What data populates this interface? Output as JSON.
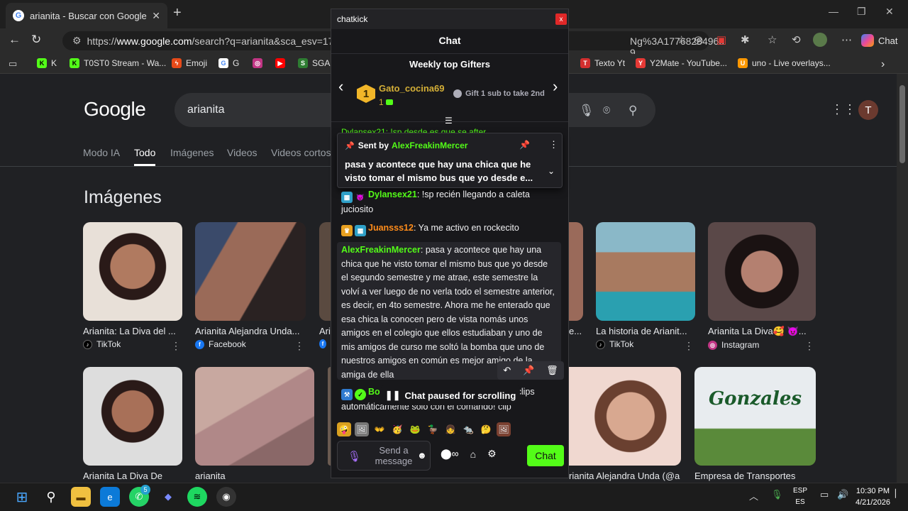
{
  "browser": {
    "tab_title": "arianita - Buscar con Google",
    "url_host": "www.google.com",
    "url_path": "/search?q=arianita&sca_esv=17de63e8",
    "url_tail": "Ng%3A17768284965​9...",
    "chat_label": "Chat",
    "bookmarks": [
      {
        "label": "K",
        "color": "#53fc18"
      },
      {
        "label": "T0ST0 Stream - Wa...",
        "color": "#53fc18"
      },
      {
        "label": "Emoji",
        "color": "#e64a19"
      },
      {
        "label": "G",
        "color": "#4285f4"
      },
      {
        "label": "",
        "color": "#c13584"
      },
      {
        "label": "",
        "color": "#ff0000"
      },
      {
        "label": "SGA",
        "color": "#2e7d32"
      },
      {
        "label": "Texto Yt",
        "color": "#d32f2f"
      },
      {
        "label": "Y2Mate - YouTube...",
        "color": "#e53935"
      },
      {
        "label": "uno - Live overlays...",
        "color": "#ff9800"
      }
    ]
  },
  "google": {
    "logo": "Google",
    "query": "arianita",
    "tabs": [
      "Modo IA",
      "Todo",
      "Imágenes",
      "Videos",
      "Videos cortos"
    ],
    "active_tab": "Todo",
    "avatar_letter": "T",
    "images_heading": "Imágenes",
    "row1": [
      {
        "caption": "Arianita: La Diva del ...",
        "source": "TikTok",
        "src_color": "#000000",
        "tone": "#7a4a3a"
      },
      {
        "caption": "Arianita Alejandra Unda...",
        "source": "Facebook",
        "src_color": "#1877f2",
        "tone": "#8a6a55"
      },
      {
        "caption": "Ari",
        "source": "",
        "src_color": "#1877f2",
        "tone": "#5a4a40"
      }
    ],
    "row1_right": [
      {
        "caption": "e...",
        "source": "",
        "src_color": "#000000",
        "tone": "#8a5a4a"
      },
      {
        "caption": "La historia de Arianit...",
        "source": "TikTok",
        "src_color": "#000000",
        "tone": "#5a8a9a"
      },
      {
        "caption": "Arianita La Diva🥰 😈...",
        "source": "Instagram",
        "src_color": "#c13584",
        "tone": "#6a5050"
      }
    ],
    "row2": [
      {
        "caption": "Arianita La Diva De",
        "tone": "#7a5a4a"
      },
      {
        "caption": "arianita",
        "tone": "#b89890"
      }
    ],
    "row2_right": [
      {
        "caption": "rianita Alejandra Unda (@a",
        "tone": "#c89a88"
      },
      {
        "caption": "Empresa de Transportes",
        "tone": "#d8dde0"
      }
    ],
    "bus_text": "Gonzales"
  },
  "chatkick": {
    "window_title": "chatkick",
    "close": "x",
    "chat_title": "Chat",
    "gifters_title": "Weekly top Gifters",
    "gifter": {
      "rank": "1",
      "name": "Gato_cocina69",
      "count": "1"
    },
    "gift_note": "Gift 1 sub to take 2nd",
    "behind_line": "Dylansex21: !sp desde es que se after",
    "pinned": {
      "sent_by": "Sent by",
      "user": "AlexFreakinMercer",
      "text": "pasa y acontece que hay una chica que he visto tomar el mismo bus que yo desde e..."
    },
    "messages": [
      {
        "user": "Dylansex21",
        "user_color": "#53fc18",
        "text": ": !sp recién llegando a caleta juciosito"
      },
      {
        "user": "Juansss12",
        "user_color": "#ff8c1a",
        "text": ": Ya me activo en rockecito"
      }
    ],
    "long_message": {
      "user": "AlexFreakinMercer",
      "user_color": "#53fc18",
      "text": ": pasa y acontece que hay una chica que he visto tomar el mismo bus que yo desde el segundo semestre y me atrae, este semestre la volví a ver luego de no verla todo el semestre anterior, es decir, en 4to semestre. Ahora me he enterado que esa chica la conocen pero de vista nomás unos amigos en el colegio que ellos estudiaban y uno de mis amigos de curso me soltó la bomba que uno de nuestros amigos en común es mejor amigo de la amiga de ella"
    },
    "last_message": {
      "user": "Bo",
      "text": "los clips automáticamente solo con el comando! clip"
    },
    "paused_label": "Chat paused for scrolling",
    "input_placeholder": "Send a message",
    "send_label": "Chat",
    "emotes": [
      "🤪",
      "🖼",
      "👐",
      "🥳",
      "🐸",
      "🦆",
      "👧",
      "🐀",
      "🤔",
      "🖼"
    ]
  },
  "taskbar": {
    "lang_line1": "ESP",
    "lang_line2": "ES",
    "time": "10:30 PM",
    "date": "4/21/2026",
    "whatsapp_badge": "5"
  }
}
